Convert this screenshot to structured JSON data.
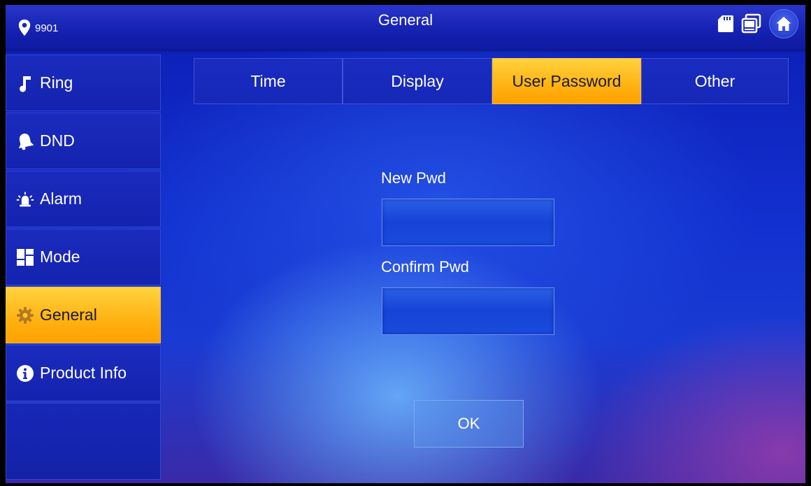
{
  "header": {
    "location": "9901",
    "title": "General"
  },
  "sidebar": {
    "items": [
      {
        "label": "Ring",
        "icon": "music-note-icon"
      },
      {
        "label": "DND",
        "icon": "bell-icon"
      },
      {
        "label": "Alarm",
        "icon": "alarm-siren-icon"
      },
      {
        "label": "Mode",
        "icon": "grid-icon"
      },
      {
        "label": "General",
        "icon": "gear-icon",
        "active": true
      },
      {
        "label": "Product Info",
        "icon": "info-icon"
      }
    ]
  },
  "tabs": [
    {
      "label": "Time"
    },
    {
      "label": "Display"
    },
    {
      "label": "User Password",
      "active": true
    },
    {
      "label": "Other"
    }
  ],
  "form": {
    "new_pwd_label": "New Pwd",
    "new_pwd_value": "",
    "confirm_pwd_label": "Confirm Pwd",
    "confirm_pwd_value": "",
    "ok_label": "OK"
  },
  "colors": {
    "accent": "#ffb212",
    "background": "#1230cf",
    "text": "#ffffff"
  }
}
